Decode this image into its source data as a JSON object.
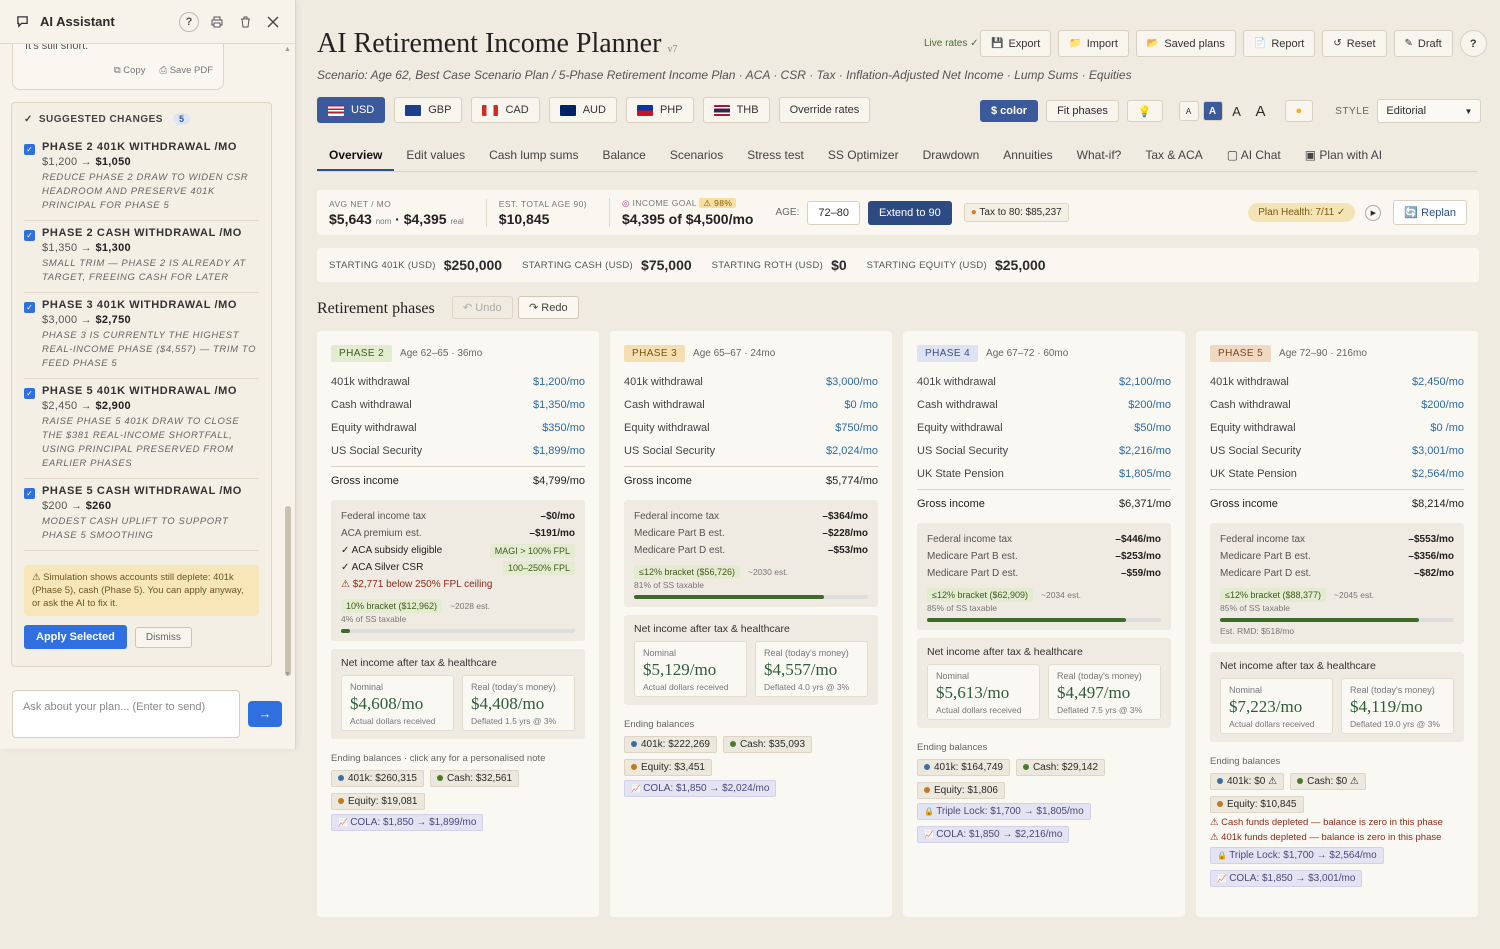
{
  "assistant": {
    "title": "AI Assistant",
    "prev_message": "It's still short.",
    "copy_label": "Copy",
    "save_pdf_label": "Save PDF",
    "suggested_title": "SUGGESTED CHANGES",
    "suggested_count": "5",
    "changes": [
      {
        "heading": "PHASE 2 401K WITHDRAWAL /MO",
        "from": "$1,200",
        "to": "$1,050",
        "desc": "REDUCE PHASE 2 DRAW TO WIDEN CSR HEADROOM AND PRESERVE 401K PRINCIPAL FOR PHASE 5"
      },
      {
        "heading": "PHASE 2 CASH WITHDRAWAL /MO",
        "from": "$1,350",
        "to": "$1,300",
        "desc": "SMALL TRIM — PHASE 2 IS ALREADY AT TARGET, FREEING CASH FOR LATER"
      },
      {
        "heading": "PHASE 3 401K WITHDRAWAL /MO",
        "from": "$3,000",
        "to": "$2,750",
        "desc": "PHASE 3 IS CURRENTLY THE HIGHEST REAL-INCOME PHASE ($4,557) — TRIM TO FEED PHASE 5"
      },
      {
        "heading": "PHASE 5 401K WITHDRAWAL /MO",
        "from": "$2,450",
        "to": "$2,900",
        "desc": "RAISE PHASE 5 401K DRAW TO CLOSE THE $381 REAL-INCOME SHORTFALL, USING PRINCIPAL PRESERVED FROM EARLIER PHASES"
      },
      {
        "heading": "PHASE 5 CASH WITHDRAWAL /MO",
        "from": "$200",
        "to": "$260",
        "desc": "MODEST CASH UPLIFT TO SUPPORT PHASE 5 SMOOTHING"
      }
    ],
    "warning": "⚠ Simulation shows accounts still deplete: 401k (Phase 5), cash (Phase 5). You can apply anyway, or ask the AI to fix it.",
    "apply_label": "Apply Selected",
    "dismiss_label": "Dismiss",
    "input_placeholder": "Ask about your plan... (Enter to send)",
    "send_icon": "→"
  },
  "header": {
    "title": "AI Retirement Income Planner",
    "version": "v7",
    "scenario": "Scenario: Age 62, Best Case Scenario Plan / 5-Phase Retirement Income Plan · ACA · CSR · Tax · Inflation-Adjusted Net Income · Lump Sums · Equities",
    "live_rates": "Live rates ✓",
    "buttons": {
      "export": "Export",
      "import": "Import",
      "saved": "Saved plans",
      "report": "Report",
      "reset": "Reset",
      "draft": "Draft",
      "help": "?"
    }
  },
  "currencies": [
    {
      "code": "USD",
      "active": true
    },
    {
      "code": "GBP",
      "active": false
    },
    {
      "code": "CAD",
      "active": false
    },
    {
      "code": "AUD",
      "active": false
    },
    {
      "code": "PHP",
      "active": false
    },
    {
      "code": "THB",
      "active": false
    }
  ],
  "override_rates": "Override rates",
  "controls": {
    "color": "$ color",
    "fit": "Fit phases",
    "font_sizes": [
      "A",
      "A",
      "A",
      "A"
    ],
    "style_label": "STYLE",
    "style_value": "Editorial"
  },
  "tabs": [
    "Overview",
    "Edit values",
    "Cash lump sums",
    "Balance",
    "Scenarios",
    "Stress test",
    "SS Optimizer",
    "Drawdown",
    "Annuities",
    "What-if?",
    "Tax & ACA",
    "AI Chat",
    "Plan with AI"
  ],
  "stats": {
    "avg_label": "AVG NET / MO",
    "avg_nom": "$5,643",
    "nom": "nom",
    "avg_real": "$4,395",
    "real": "real",
    "total_label": "EST. TOTAL AGE 90)",
    "total": "$10,845",
    "goal_label": "INCOME GOAL",
    "goal_pct": "⚠ 98%",
    "goal_value": "$4,395 of $4,500/mo",
    "age_label": "AGE:",
    "age_range": "72–80",
    "extend": "Extend to 90",
    "tax_to": "Tax to 80: $85,237",
    "health": "Plan Health: 7/11 ✓",
    "replan": "Replan"
  },
  "starting": [
    {
      "label": "STARTING 401K (USD)",
      "value": "$250,000"
    },
    {
      "label": "STARTING CASH (USD)",
      "value": "$75,000"
    },
    {
      "label": "STARTING ROTH (USD)",
      "value": "$0"
    },
    {
      "label": "STARTING EQUITY (USD)",
      "value": "$25,000"
    }
  ],
  "phases_title": "Retirement phases",
  "undo": "Undo",
  "redo": "Redo",
  "phases": [
    {
      "badge": "PHASE 2",
      "age": "Age 62–65 · 36mo",
      "rows": [
        [
          "401k withdrawal",
          "$1,200/mo"
        ],
        [
          "Cash withdrawal",
          "$1,350/mo"
        ],
        [
          "Equity withdrawal",
          "$350/mo"
        ],
        [
          "US Social Security",
          "$1,899/mo"
        ]
      ],
      "gross": "$4,799/mo",
      "tax": [
        [
          "Federal income tax",
          "–$0/mo"
        ],
        [
          "ACA premium est.",
          "–$191/mo"
        ]
      ],
      "aca": [
        "✓ ACA subsidy eligible",
        "MAGI > 100% FPL",
        "✓ ACA Silver CSR",
        "100–250% FPL",
        "⚠ $2,771 below 250% FPL ceiling"
      ],
      "bracket": "10% bracket ($12,962)",
      "bracket_est": "~2028 est.",
      "ss_taxable": "4% of SS taxable",
      "ss_pct": 0.04,
      "nominal": "$4,608/mo",
      "real": "$4,408/mo",
      "real_note": "Deflated 1.5 yrs @ 3%",
      "ending_label": "Ending balances · click any for a personalised note",
      "balances": [
        "401k: $260,315",
        "Cash: $32,561",
        "Equity: $19,081"
      ],
      "notes": [
        "COLA: $1,850 → $1,899/mo"
      ]
    },
    {
      "badge": "PHASE 3",
      "age": "Age 65–67 · 24mo",
      "rows": [
        [
          "401k withdrawal",
          "$3,000/mo"
        ],
        [
          "Cash withdrawal",
          "$0  /mo"
        ],
        [
          "Equity withdrawal",
          "$750/mo"
        ],
        [
          "US Social Security",
          "$2,024/mo"
        ]
      ],
      "gross": "$5,774/mo",
      "tax": [
        [
          "Federal income tax",
          "–$364/mo"
        ],
        [
          "Medicare Part B est.",
          "–$228/mo"
        ],
        [
          "Medicare Part D est.",
          "–$53/mo"
        ]
      ],
      "bracket": "≤12% bracket ($56,726)",
      "bracket_est": "~2030 est.",
      "ss_taxable": "81% of SS taxable",
      "ss_pct": 0.81,
      "nominal": "$5,129/mo",
      "real": "$4,557/mo",
      "real_note": "Deflated 4.0 yrs @ 3%",
      "ending_label": "Ending balances",
      "balances": [
        "401k: $222,269",
        "Cash: $35,093",
        "Equity: $3,451"
      ],
      "notes": [
        "COLA: $1,850 → $2,024/mo"
      ]
    },
    {
      "badge": "PHASE 4",
      "age": "Age 67–72 · 60mo",
      "rows": [
        [
          "401k withdrawal",
          "$2,100/mo"
        ],
        [
          "Cash withdrawal",
          "$200/mo"
        ],
        [
          "Equity withdrawal",
          "$50/mo"
        ],
        [
          "US Social Security",
          "$2,216/mo"
        ],
        [
          "UK State Pension",
          "$1,805/mo"
        ]
      ],
      "gross": "$6,371/mo",
      "tax": [
        [
          "Federal income tax",
          "–$446/mo"
        ],
        [
          "Medicare Part B est.",
          "–$253/mo"
        ],
        [
          "Medicare Part D est.",
          "–$59/mo"
        ]
      ],
      "bracket": "≤12% bracket ($62,909)",
      "bracket_est": "~2034 est.",
      "ss_taxable": "85% of SS taxable",
      "ss_pct": 0.85,
      "nominal": "$5,613/mo",
      "real": "$4,497/mo",
      "real_note": "Deflated 7.5 yrs @ 3%",
      "ending_label": "Ending balances",
      "balances": [
        "401k: $164,749",
        "Cash: $29,142",
        "Equity: $1,806"
      ],
      "notes": [
        "Triple Lock: $1,700 → $1,805/mo",
        "COLA: $1,850 → $2,216/mo"
      ]
    },
    {
      "badge": "PHASE 5",
      "age": "Age 72–90 · 216mo",
      "rows": [
        [
          "401k withdrawal",
          "$2,450/mo"
        ],
        [
          "Cash withdrawal",
          "$200/mo"
        ],
        [
          "Equity withdrawal",
          "$0  /mo"
        ],
        [
          "US Social Security",
          "$3,001/mo"
        ],
        [
          "UK State Pension",
          "$2,564/mo"
        ]
      ],
      "gross": "$8,214/mo",
      "tax": [
        [
          "Federal income tax",
          "–$553/mo"
        ],
        [
          "Medicare Part B est.",
          "–$356/mo"
        ],
        [
          "Medicare Part D est.",
          "–$82/mo"
        ]
      ],
      "bracket": "≤12% bracket ($88,377)",
      "bracket_est": "~2045 est.",
      "ss_taxable": "85% of SS taxable",
      "ss_pct": 0.85,
      "rmd": "Est. RMD: $518/mo",
      "nominal": "$7,223/mo",
      "real": "$4,119/mo",
      "real_note": "Deflated 19.0 yrs @ 3%",
      "ending_label": "Ending balances",
      "balances": [
        "401k: $0 ⚠",
        "Cash: $0 ⚠",
        "Equity: $10,845"
      ],
      "depleted": [
        "⚠ Cash funds depleted — balance is zero in this phase",
        "⚠ 401k funds depleted — balance is zero in this phase"
      ],
      "notes": [
        "Triple Lock: $1,700 → $2,564/mo",
        "COLA: $1,850 → $3,001/mo"
      ]
    }
  ],
  "labels": {
    "gross": "Gross income",
    "net_title": "Net income after tax & healthcare",
    "nominal": "Nominal",
    "real": "Real (today's money)",
    "actual": "Actual dollars received"
  },
  "colors": {
    "accent": "#2f6fe0",
    "primary": "#3a5a9c",
    "green": "#2f5c3a"
  }
}
